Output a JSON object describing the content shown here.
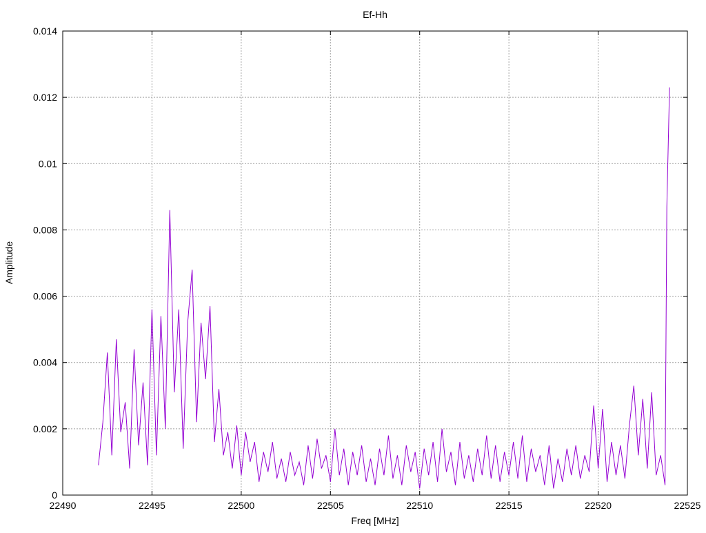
{
  "chart_data": {
    "type": "line",
    "title": "Ef-Hh",
    "xlabel": "Freq [MHz]",
    "ylabel": "Amplitude",
    "xlim": [
      22490,
      22525
    ],
    "ylim": [
      0,
      0.014
    ],
    "xticks": [
      22490,
      22495,
      22500,
      22505,
      22510,
      22515,
      22520,
      22525
    ],
    "xtick_labels": [
      "22490",
      "22495",
      "22500",
      "22505",
      "22510",
      "22515",
      "22520",
      "22525"
    ],
    "yticks": [
      0,
      0.002,
      0.004,
      0.006,
      0.008,
      0.01,
      0.012,
      0.014
    ],
    "ytick_labels": [
      "0",
      "0.002",
      "0.004",
      "0.006",
      "0.008",
      "0.01",
      "0.012",
      "0.014"
    ],
    "grid": true,
    "line_color": "#9400d3",
    "series": [
      {
        "name": "Ef-Hh",
        "points": [
          [
            22492,
            0.0009
          ],
          [
            22492.25,
            0.0022
          ],
          [
            22492.5,
            0.0043
          ],
          [
            22492.75,
            0.0012
          ],
          [
            22493,
            0.0047
          ],
          [
            22493.25,
            0.0019
          ],
          [
            22493.5,
            0.0028
          ],
          [
            22493.75,
            0.0008
          ],
          [
            22494,
            0.0044
          ],
          [
            22494.25,
            0.0015
          ],
          [
            22494.5,
            0.0034
          ],
          [
            22494.75,
            0.0009
          ],
          [
            22495,
            0.0056
          ],
          [
            22495.25,
            0.0012
          ],
          [
            22495.5,
            0.0054
          ],
          [
            22495.75,
            0.002
          ],
          [
            22496,
            0.0086
          ],
          [
            22496.25,
            0.0031
          ],
          [
            22496.5,
            0.0056
          ],
          [
            22496.75,
            0.0014
          ],
          [
            22497,
            0.0052
          ],
          [
            22497.25,
            0.0068
          ],
          [
            22497.5,
            0.0022
          ],
          [
            22497.75,
            0.0052
          ],
          [
            22498,
            0.0035
          ],
          [
            22498.25,
            0.0057
          ],
          [
            22498.5,
            0.0016
          ],
          [
            22498.75,
            0.0032
          ],
          [
            22499,
            0.0012
          ],
          [
            22499.25,
            0.0019
          ],
          [
            22499.5,
            0.0008
          ],
          [
            22499.75,
            0.0021
          ],
          [
            22500,
            0.0006
          ],
          [
            22500.25,
            0.0019
          ],
          [
            22500.5,
            0.001
          ],
          [
            22500.75,
            0.0016
          ],
          [
            22501,
            0.0004
          ],
          [
            22501.25,
            0.0013
          ],
          [
            22501.5,
            0.0007
          ],
          [
            22501.75,
            0.0016
          ],
          [
            22502,
            0.0005
          ],
          [
            22502.25,
            0.0011
          ],
          [
            22502.5,
            0.0004
          ],
          [
            22502.75,
            0.0013
          ],
          [
            22503,
            0.0006
          ],
          [
            22503.25,
            0.001
          ],
          [
            22503.5,
            0.0003
          ],
          [
            22503.75,
            0.0015
          ],
          [
            22504,
            0.0005
          ],
          [
            22504.25,
            0.0017
          ],
          [
            22504.5,
            0.0008
          ],
          [
            22504.75,
            0.0012
          ],
          [
            22505,
            0.0004
          ],
          [
            22505.25,
            0.002
          ],
          [
            22505.5,
            0.0006
          ],
          [
            22505.75,
            0.0014
          ],
          [
            22506,
            0.0003
          ],
          [
            22506.25,
            0.0013
          ],
          [
            22506.5,
            0.0006
          ],
          [
            22506.75,
            0.0015
          ],
          [
            22507,
            0.0004
          ],
          [
            22507.25,
            0.0011
          ],
          [
            22507.5,
            0.0003
          ],
          [
            22507.75,
            0.0014
          ],
          [
            22508,
            0.0006
          ],
          [
            22508.25,
            0.0018
          ],
          [
            22508.5,
            0.0005
          ],
          [
            22508.75,
            0.0012
          ],
          [
            22509,
            0.0003
          ],
          [
            22509.25,
            0.0015
          ],
          [
            22509.5,
            0.0007
          ],
          [
            22509.75,
            0.0013
          ],
          [
            22510,
            0.0002
          ],
          [
            22510.25,
            0.0014
          ],
          [
            22510.5,
            0.0006
          ],
          [
            22510.75,
            0.0016
          ],
          [
            22511,
            0.0004
          ],
          [
            22511.25,
            0.002
          ],
          [
            22511.5,
            0.0007
          ],
          [
            22511.75,
            0.0013
          ],
          [
            22512,
            0.0003
          ],
          [
            22512.25,
            0.0016
          ],
          [
            22512.5,
            0.0005
          ],
          [
            22512.75,
            0.0012
          ],
          [
            22513,
            0.0004
          ],
          [
            22513.25,
            0.0014
          ],
          [
            22513.5,
            0.0006
          ],
          [
            22513.75,
            0.0018
          ],
          [
            22514,
            0.0005
          ],
          [
            22514.25,
            0.0015
          ],
          [
            22514.5,
            0.0004
          ],
          [
            22514.75,
            0.0013
          ],
          [
            22515,
            0.0006
          ],
          [
            22515.25,
            0.0016
          ],
          [
            22515.5,
            0.0005
          ],
          [
            22515.75,
            0.0018
          ],
          [
            22516,
            0.0004
          ],
          [
            22516.25,
            0.0014
          ],
          [
            22516.5,
            0.0007
          ],
          [
            22516.75,
            0.0012
          ],
          [
            22517,
            0.0003
          ],
          [
            22517.25,
            0.0015
          ],
          [
            22517.5,
            0.0002
          ],
          [
            22517.75,
            0.0011
          ],
          [
            22518,
            0.0004
          ],
          [
            22518.25,
            0.0014
          ],
          [
            22518.5,
            0.0006
          ],
          [
            22518.75,
            0.0015
          ],
          [
            22519,
            0.0005
          ],
          [
            22519.25,
            0.0012
          ],
          [
            22519.5,
            0.0007
          ],
          [
            22519.75,
            0.0027
          ],
          [
            22520,
            0.0008
          ],
          [
            22520.25,
            0.0026
          ],
          [
            22520.5,
            0.0004
          ],
          [
            22520.75,
            0.0016
          ],
          [
            22521,
            0.0006
          ],
          [
            22521.25,
            0.0015
          ],
          [
            22521.5,
            0.0005
          ],
          [
            22521.75,
            0.0021
          ],
          [
            22522,
            0.0033
          ],
          [
            22522.25,
            0.0012
          ],
          [
            22522.5,
            0.0029
          ],
          [
            22522.75,
            0.0008
          ],
          [
            22523,
            0.0031
          ],
          [
            22523.25,
            0.0006
          ],
          [
            22523.5,
            0.0012
          ],
          [
            22523.75,
            0.0003
          ],
          [
            22523.85,
            0.0087
          ],
          [
            22524,
            0.0123
          ]
        ]
      }
    ]
  }
}
